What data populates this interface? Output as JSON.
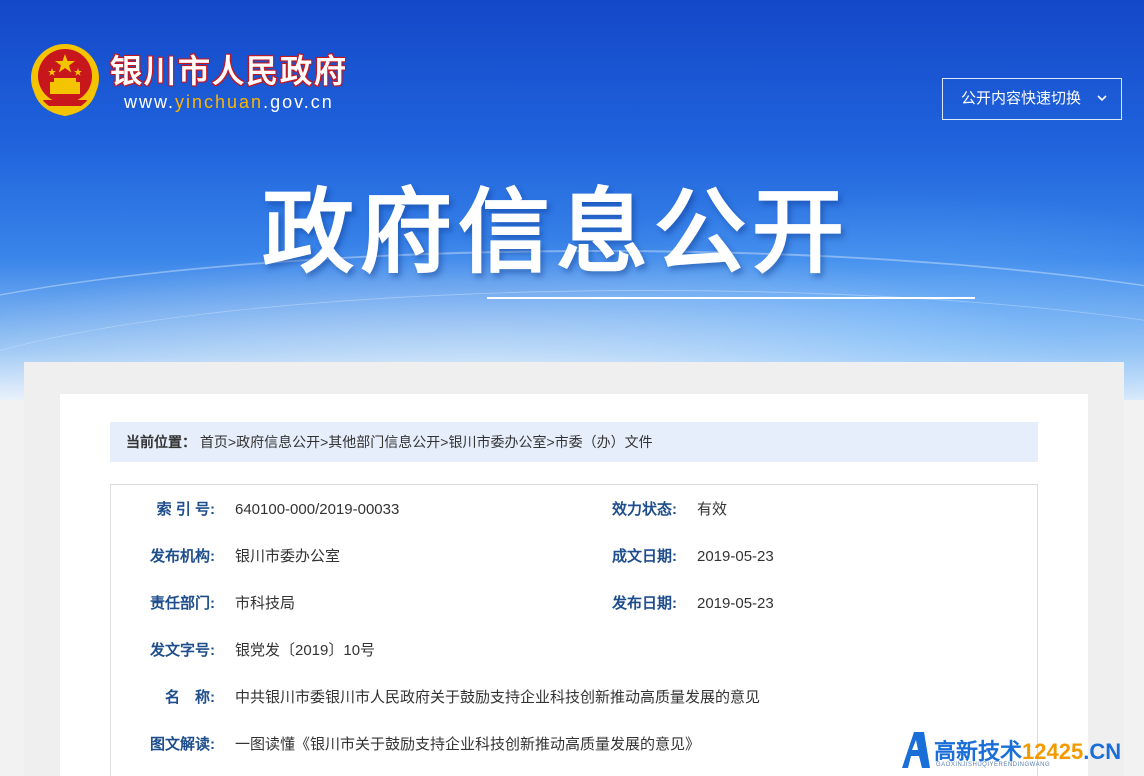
{
  "header": {
    "site_name": "银川市人民政府",
    "url_prefix": "www.",
    "url_highlight": "yinchuan",
    "url_suffix": ".gov.cn",
    "quick_switch_label": "公开内容快速切换",
    "quick_switch_icon": "chevron-down-icon"
  },
  "hero": {
    "title": "政府信息公开"
  },
  "breadcrumb": {
    "label": "当前位置：",
    "items": [
      "首页",
      "政府信息公开",
      "其他部门信息公开",
      "银川市委办公室",
      "市委（办）文件"
    ],
    "separator": ">"
  },
  "meta": {
    "index_no_label": "索 引 号:",
    "index_no": "640100-000/2019-00033",
    "status_label": "效力状态:",
    "status": "有效",
    "publisher_label": "发布机构:",
    "publisher": "银川市委办公室",
    "created_label": "成文日期:",
    "created": "2019-05-23",
    "dept_label": "责任部门:",
    "dept": "市科技局",
    "published_label": "发布日期:",
    "published": "2019-05-23",
    "doc_no_label": "发文字号:",
    "doc_no": "银党发〔2019〕10号",
    "name_label": "名　称:",
    "name": "中共银川市委银川市人民政府关于鼓励支持企业科技创新推动高质量发展的意见",
    "interpret_label": "图文解读:",
    "interpret": "一图读懂《银川市关于鼓励支持企业科技创新推动高质量发展的意见》"
  },
  "watermark": {
    "text_prefix": "高新技术",
    "text_num": "12425",
    "text_suffix": ".CN",
    "subtext": "GAOXINJISHUQIYERENDINGWANG"
  },
  "colors": {
    "header_blue": "#1f62dc",
    "label_blue": "#1f4e8c",
    "breadcrumb_bg": "#e5eefa",
    "emblem_red": "#c8161d",
    "emblem_gold": "#f5c400"
  }
}
